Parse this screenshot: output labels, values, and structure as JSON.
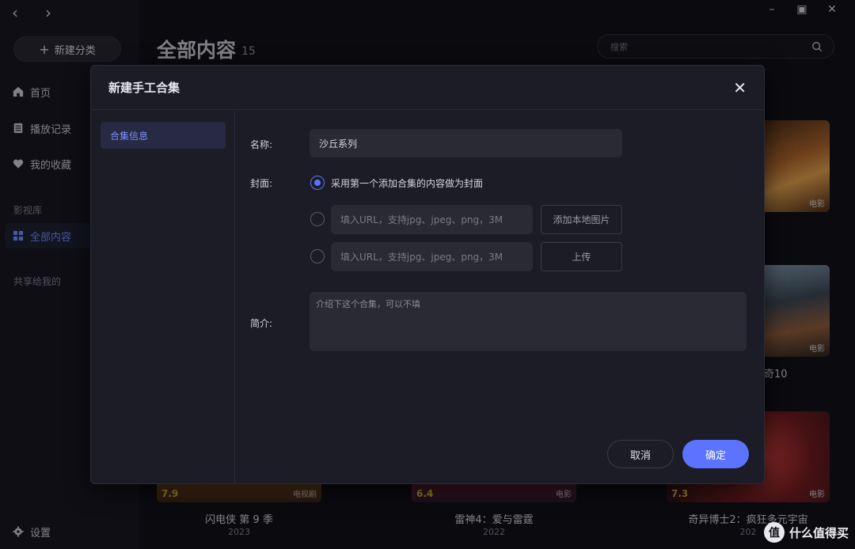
{
  "nav": {
    "back": "‹",
    "forward": "›"
  },
  "sidebar": {
    "new_category": "新建分类",
    "items": [
      {
        "label": "首页"
      },
      {
        "label": "播放记录"
      },
      {
        "label": "我的收藏"
      }
    ],
    "library_section": "影视库",
    "library_item": "全部内容",
    "shared_section": "共享给我的",
    "settings": "设置"
  },
  "main": {
    "title": "全部内容",
    "count": "15",
    "search_placeholder": "搜索"
  },
  "cards": [
    {
      "type": "电影",
      "score": "",
      "title": "",
      "year": ""
    },
    {
      "type": "电影",
      "score": "",
      "title": "…奇10",
      "year": ""
    },
    {
      "type": "电视剧",
      "score": "7.9",
      "title": "闪电侠 第 9 季",
      "year": "2023"
    },
    {
      "type": "电影",
      "score": "6.4",
      "title": "雷神4：爱与雷霆",
      "year": "2022"
    },
    {
      "type": "电影",
      "score": "7.3",
      "title": "奇异博士2：疯狂多元宇宙",
      "year": "202"
    }
  ],
  "modal": {
    "title": "新建手工合集",
    "close": "✕",
    "tab": "合集信息",
    "name_label": "名称:",
    "name_value": "沙丘系列",
    "cover_label": "封面:",
    "cover_option1": "采用第一个添加合集的内容做为封面",
    "url_placeholder": "填入URL，支持jpg、jpeg、png，3M",
    "add_local": "添加本地图片",
    "upload": "上传",
    "intro_label": "简介:",
    "intro_placeholder": "介绍下这个合集，可以不填",
    "cancel": "取消",
    "confirm": "确定"
  },
  "watermark": {
    "icon": "值",
    "text": "什么值得买"
  },
  "colors": {
    "accent": "#5c73ff",
    "sidebar_active": "#6e86ff",
    "score": "#e7b64a"
  }
}
